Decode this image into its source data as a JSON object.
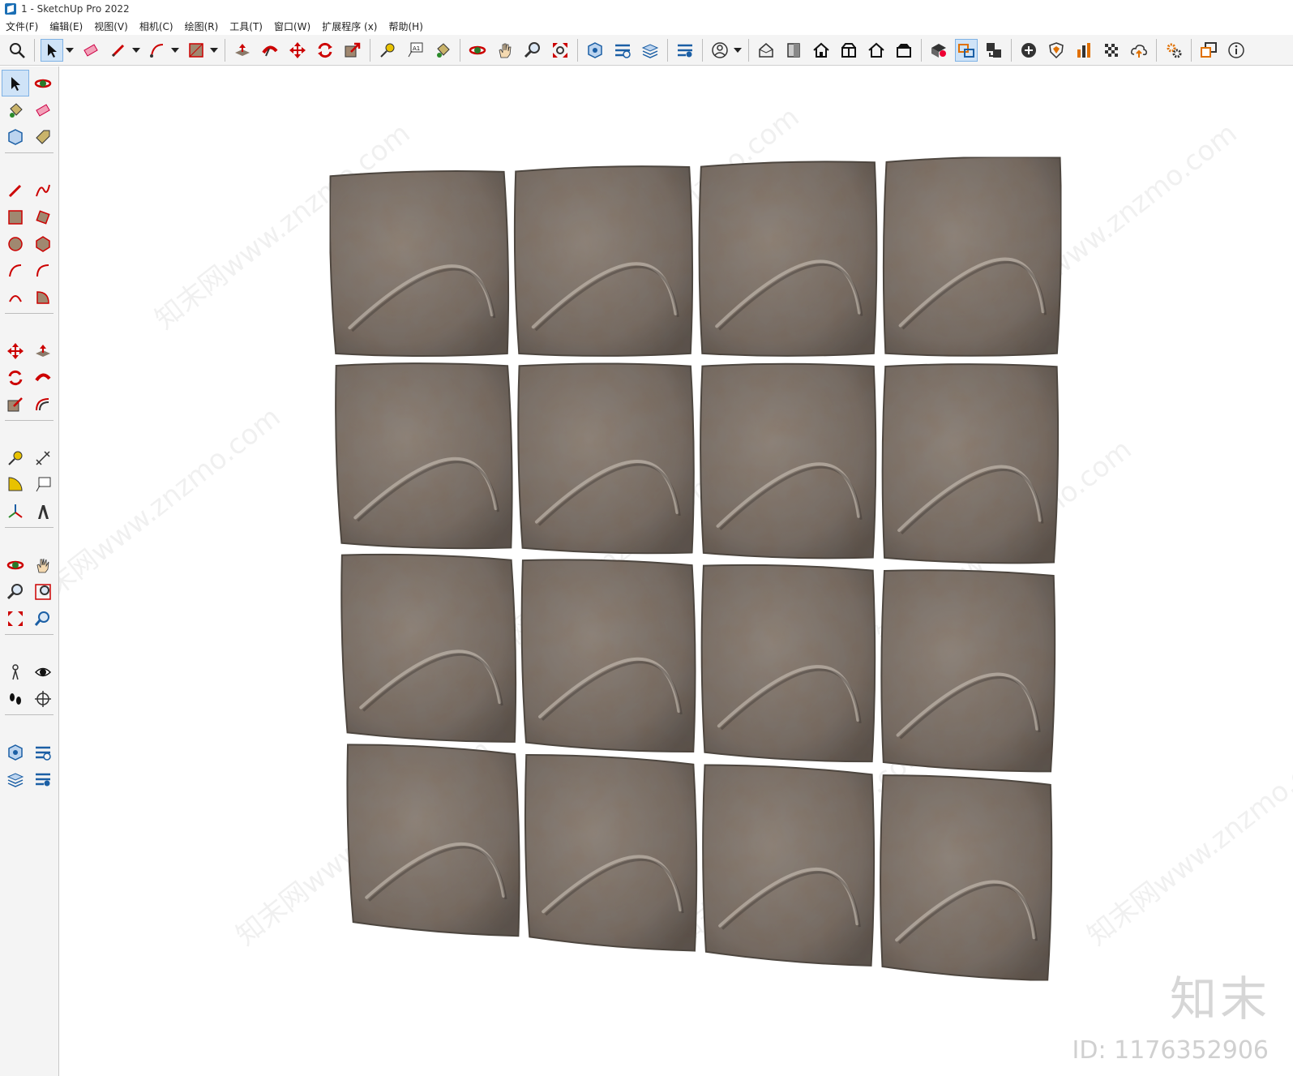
{
  "window": {
    "title": "1 - SketchUp Pro 2022"
  },
  "menu": [
    "文件(F)",
    "编辑(E)",
    "视图(V)",
    "相机(C)",
    "绘图(R)",
    "工具(T)",
    "窗口(W)",
    "扩展程序 (x)",
    "帮助(H)"
  ],
  "toolbar": {
    "tools": [
      "search-icon",
      "select-icon",
      "eraser-icon",
      "pencil-icon",
      "arc-icon",
      "rectangle-icon",
      "push-pull-icon",
      "follow-me-icon",
      "move-icon",
      "rotate-icon",
      "scale-icon",
      "tape-measure-icon",
      "text-icon",
      "paint-bucket-icon",
      "orbit-icon",
      "pan-icon",
      "zoom-icon",
      "zoom-extents-icon",
      "solid-tools-icon",
      "section-icon",
      "layers-icon",
      "styles-icon",
      "account-icon",
      "iso-view-icon",
      "front-view-icon",
      "home-view-icon",
      "right-view-icon",
      "back-view-icon",
      "top-view-icon",
      "warehouse-icon",
      "share-icon",
      "extensions-icon",
      "add-icon",
      "shield-icon",
      "chart-icon",
      "checker-icon",
      "cloud-icon",
      "settings-icon",
      "dialog-icon",
      "info-icon"
    ]
  },
  "left_tools": [
    "select-icon",
    "orbit-icon",
    "paint-bucket-icon",
    "eraser-icon",
    "component-icon",
    "tag-icon",
    "pencil-icon",
    "freehand-icon",
    "rectangle-icon",
    "rotated-rectangle-icon",
    "circle-icon",
    "polygon-icon",
    "arc-icon",
    "arc-2pt-icon",
    "arc-3pt-icon",
    "pie-icon",
    "move-icon",
    "push-pull-icon",
    "rotate-icon",
    "follow-me-icon",
    "scale-icon",
    "offset-icon",
    "tape-measure-icon",
    "dimension-icon",
    "protractor-icon",
    "text-icon",
    "axes-icon",
    "3d-text-icon",
    "orbit-icon",
    "pan-icon",
    "zoom-icon",
    "zoom-window-icon",
    "zoom-extents-icon",
    "previous-view-icon",
    "position-camera-icon",
    "look-around-icon",
    "walk-icon",
    "section-plane-icon",
    "solid-tools-icon",
    "section-display-icon",
    "layers-icon",
    "styles-icon"
  ],
  "viewport": {
    "watermark_text": "知末网www.znzmo.com",
    "brand": "知末",
    "model_id": "ID: 1176352906"
  },
  "colors": {
    "toolbar_bg": "#f4f4f4",
    "accent": "#1b6fb5",
    "stone": "#7a7068"
  }
}
